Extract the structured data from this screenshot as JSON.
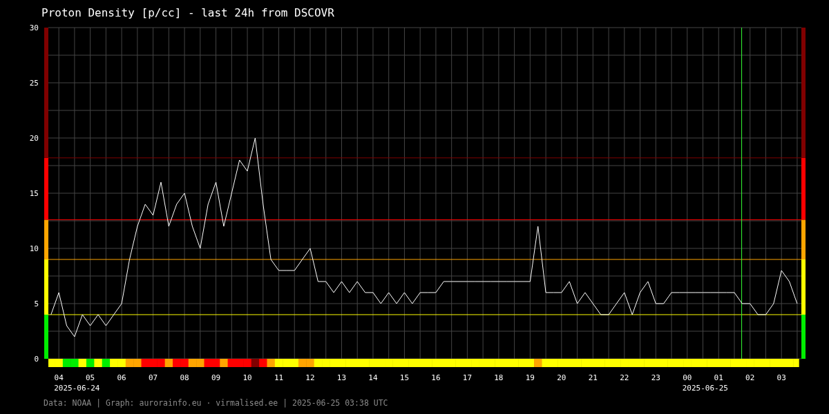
{
  "title": "Proton Density [p/cc] - last 24h from DSCOVR",
  "chart": {
    "chart_data": {
      "type": "line",
      "grid": true,
      "x": [
        "2025-06-24T03:45",
        "2025-06-24T04:00",
        "2025-06-24T04:15",
        "2025-06-24T04:30",
        "2025-06-24T04:45",
        "2025-06-24T05:00",
        "2025-06-24T05:15",
        "2025-06-24T05:30",
        "2025-06-24T05:45",
        "2025-06-24T06:00",
        "2025-06-24T06:15",
        "2025-06-24T06:30",
        "2025-06-24T06:45",
        "2025-06-24T07:00",
        "2025-06-24T07:15",
        "2025-06-24T07:30",
        "2025-06-24T07:45",
        "2025-06-24T08:00",
        "2025-06-24T08:15",
        "2025-06-24T08:30",
        "2025-06-24T08:45",
        "2025-06-24T09:00",
        "2025-06-24T09:15",
        "2025-06-24T09:30",
        "2025-06-24T09:45",
        "2025-06-24T10:00",
        "2025-06-24T10:15",
        "2025-06-24T10:30",
        "2025-06-24T10:45",
        "2025-06-24T11:00",
        "2025-06-24T11:15",
        "2025-06-24T11:30",
        "2025-06-24T11:45",
        "2025-06-24T12:00",
        "2025-06-24T12:15",
        "2025-06-24T12:30",
        "2025-06-24T12:45",
        "2025-06-24T13:00",
        "2025-06-24T13:15",
        "2025-06-24T13:30",
        "2025-06-24T13:45",
        "2025-06-24T14:00",
        "2025-06-24T14:15",
        "2025-06-24T14:30",
        "2025-06-24T14:45",
        "2025-06-24T15:00",
        "2025-06-24T15:15",
        "2025-06-24T15:30",
        "2025-06-24T15:45",
        "2025-06-24T16:00",
        "2025-06-24T16:15",
        "2025-06-24T16:30",
        "2025-06-24T16:45",
        "2025-06-24T17:00",
        "2025-06-24T17:15",
        "2025-06-24T17:30",
        "2025-06-24T17:45",
        "2025-06-24T18:00",
        "2025-06-24T18:15",
        "2025-06-24T18:30",
        "2025-06-24T18:45",
        "2025-06-24T19:00",
        "2025-06-24T19:15",
        "2025-06-24T19:30",
        "2025-06-24T19:45",
        "2025-06-24T20:00",
        "2025-06-24T20:15",
        "2025-06-24T20:30",
        "2025-06-24T20:45",
        "2025-06-24T21:00",
        "2025-06-24T21:15",
        "2025-06-24T21:30",
        "2025-06-24T21:45",
        "2025-06-24T22:00",
        "2025-06-24T22:15",
        "2025-06-24T22:30",
        "2025-06-24T22:45",
        "2025-06-24T23:00",
        "2025-06-24T23:15",
        "2025-06-24T23:30",
        "2025-06-24T23:45",
        "2025-06-25T00:00",
        "2025-06-25T00:15",
        "2025-06-25T00:30",
        "2025-06-25T00:45",
        "2025-06-25T01:00",
        "2025-06-25T01:15",
        "2025-06-25T01:30",
        "2025-06-25T01:45",
        "2025-06-25T02:00",
        "2025-06-25T02:15",
        "2025-06-25T02:30",
        "2025-06-25T02:45",
        "2025-06-25T03:00",
        "2025-06-25T03:15",
        "2025-06-25T03:30"
      ],
      "series": [
        {
          "color": "#ffffff",
          "values": [
            4,
            6,
            3,
            2,
            4,
            3,
            4,
            3,
            4,
            5,
            9,
            12,
            14,
            13,
            16,
            12,
            14,
            15,
            12,
            10,
            14,
            16,
            12,
            15,
            18,
            17,
            20,
            14,
            9,
            8,
            8,
            8,
            9,
            10,
            7,
            7,
            6,
            7,
            6,
            7,
            6,
            6,
            5,
            6,
            5,
            6,
            5,
            6,
            6,
            6,
            7,
            7,
            7,
            7,
            7,
            7,
            7,
            7,
            7,
            7,
            7,
            7,
            12,
            6,
            6,
            6,
            7,
            5,
            6,
            5,
            4,
            4,
            5,
            6,
            4,
            6,
            7,
            5,
            5,
            6,
            6,
            6,
            6,
            6,
            6,
            6,
            6,
            6,
            5,
            5,
            4,
            4,
            5,
            8,
            7,
            5
          ]
        }
      ],
      "xlim": [
        "2025-06-24T03:40",
        "2025-06-25T03:38"
      ],
      "ylim": [
        0,
        30
      ],
      "yticks": [
        0,
        5,
        10,
        15,
        20,
        25,
        30
      ],
      "xticks": [
        {
          "value": "2025-06-24T04:00",
          "label": "04"
        },
        {
          "value": "2025-06-24T05:00",
          "label": "05"
        },
        {
          "value": "2025-06-24T06:00",
          "label": "06"
        },
        {
          "value": "2025-06-24T07:00",
          "label": "07"
        },
        {
          "value": "2025-06-24T08:00",
          "label": "08"
        },
        {
          "value": "2025-06-24T09:00",
          "label": "09"
        },
        {
          "value": "2025-06-24T10:00",
          "label": "10"
        },
        {
          "value": "2025-06-24T11:00",
          "label": "11"
        },
        {
          "value": "2025-06-24T12:00",
          "label": "12"
        },
        {
          "value": "2025-06-24T13:00",
          "label": "13"
        },
        {
          "value": "2025-06-24T14:00",
          "label": "14"
        },
        {
          "value": "2025-06-24T15:00",
          "label": "15"
        },
        {
          "value": "2025-06-24T16:00",
          "label": "16"
        },
        {
          "value": "2025-06-24T17:00",
          "label": "17"
        },
        {
          "value": "2025-06-24T18:00",
          "label": "18"
        },
        {
          "value": "2025-06-24T19:00",
          "label": "19"
        },
        {
          "value": "2025-06-24T20:00",
          "label": "20"
        },
        {
          "value": "2025-06-24T21:00",
          "label": "21"
        },
        {
          "value": "2025-06-24T22:00",
          "label": "22"
        },
        {
          "value": "2025-06-24T23:00",
          "label": "23"
        },
        {
          "value": "2025-06-25T00:00",
          "label": "00"
        },
        {
          "value": "2025-06-25T01:00",
          "label": "01"
        },
        {
          "value": "2025-06-25T02:00",
          "label": "02"
        },
        {
          "value": "2025-06-25T03:00",
          "label": "03"
        }
      ],
      "ref_lines": [
        {
          "axis": "y",
          "value": 4,
          "color": "#ffff00"
        },
        {
          "axis": "y",
          "value": 9,
          "color": "#ffa500"
        },
        {
          "axis": "y",
          "value": 12.6,
          "color": "#ff0000"
        },
        {
          "axis": "y",
          "value": 18.2,
          "color": "#800000"
        },
        {
          "axis": "x",
          "value": "2025-06-25T01:44",
          "color": "#33ff33"
        }
      ]
    },
    "date_labels": [
      "2025-06-24",
      "2025-06-25"
    ]
  },
  "footer": "Data: NOAA | Graph: aurorainfo.eu · virmalised.ee | 2025-06-25 03:38 UTC"
}
